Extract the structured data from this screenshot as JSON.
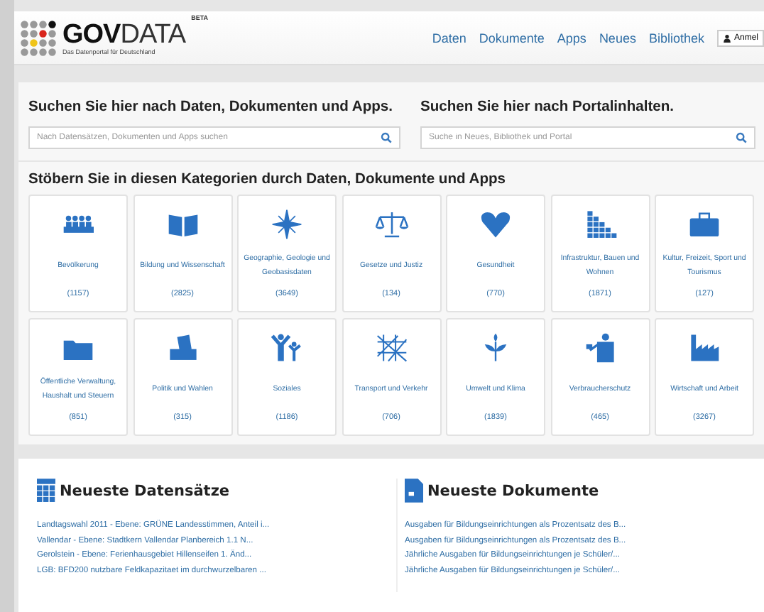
{
  "header": {
    "logo_text_bold": "GOV",
    "logo_text": "DATA",
    "badge": "BETA",
    "tagline": "Das Datenportal für Deutschland",
    "nav": [
      "Daten",
      "Dokumente",
      "Apps",
      "Neues",
      "Bibliothek"
    ],
    "login": "Anmel"
  },
  "search": [
    {
      "heading": "Suchen Sie hier nach Daten, Dokumenten und Apps.",
      "placeholder": "Nach Datensätzen, Dokumenten und Apps suchen"
    },
    {
      "heading": "Suchen Sie hier nach Portalinhalten.",
      "placeholder": "Suche in Neues, Bibliothek und Portal"
    }
  ],
  "categories": {
    "heading": "Stöbern Sie in diesen Kategorien durch Daten, Dokumente und Apps",
    "items": [
      {
        "label": "Bevölkerung",
        "count": "(1157)"
      },
      {
        "label": "Bildung und Wissenschaft",
        "count": "(2825)"
      },
      {
        "label": "Geographie, Geologie und Geobasisdaten",
        "count": "(3649)"
      },
      {
        "label": "Gesetze und Justiz",
        "count": "(134)"
      },
      {
        "label": "Gesundheit",
        "count": "(770)"
      },
      {
        "label": "Infrastruktur, Bauen und Wohnen",
        "count": "(1871)"
      },
      {
        "label": "Kultur, Freizeit, Sport und Tourismus",
        "count": "(127)"
      },
      {
        "label": "Öffentliche Verwaltung, Haushalt und Steuern",
        "count": "(851)"
      },
      {
        "label": "Politik und Wahlen",
        "count": "(315)"
      },
      {
        "label": "Soziales",
        "count": "(1186)"
      },
      {
        "label": "Transport und Verkehr",
        "count": "(706)"
      },
      {
        "label": "Umwelt und Klima",
        "count": "(1839)"
      },
      {
        "label": "Verbraucherschutz",
        "count": "(465)"
      },
      {
        "label": "Wirtschaft und Arbeit",
        "count": "(3267)"
      }
    ]
  },
  "latest": [
    {
      "kind": "datasets",
      "title": "Neueste Datensätze",
      "links": [
        "Landtagswahl 2011 - Ebene: GRÜNE Landesstimmen, Anteil i...",
        "Vallendar - Ebene: Stadtkern Vallendar Planbereich 1.1 N...",
        "Gerolstein - Ebene: Ferienhausgebiet Hillenseifen 1. Änd...",
        "LGB: BFD200 nutzbare Feldkapazitaet im durchwurzelbaren ..."
      ]
    },
    {
      "kind": "documents",
      "title": "Neueste Dokumente",
      "links": [
        "Ausgaben für Bildungseinrichtungen als Prozentsatz des B...",
        "Ausgaben für Bildungseinrichtungen als Prozentsatz des B...",
        "Jährliche Ausgaben für Bildungseinrichtungen je Schüler/...",
        "Jährliche Ausgaben für Bildungseinrichtungen je Schüler/..."
      ]
    }
  ]
}
